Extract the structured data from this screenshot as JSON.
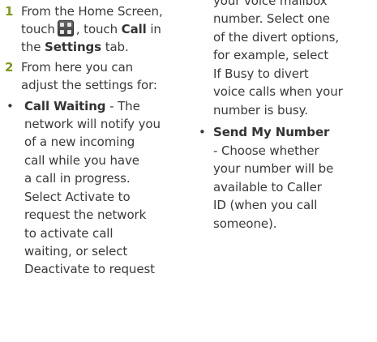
{
  "left": {
    "step1": {
      "num": "1",
      "line1": "From the Home Screen,",
      "line2_pre": "touch",
      "line2_mid": ", touch",
      "line2_call": "Call",
      "line2_post": "in",
      "line3_pre": "the",
      "line3_bold": "Settings",
      "line3_post": "tab.",
      "icon": "apps-grid-icon"
    },
    "step2": {
      "num": "2",
      "line1": "From here you can",
      "line2": "adjust the settings for:"
    },
    "call_waiting": {
      "bullet": "•",
      "title": "Call Waiting",
      "title_rest": "- The",
      "lines": [
        "network will notify you",
        "of a new incoming",
        "call while you have",
        "a call in progress.",
        "Select Activate to",
        "request the network",
        "to activate call",
        "waiting, or select",
        "Deactivate to request"
      ]
    }
  },
  "right": {
    "divert_lines": [
      "your voice mailbox",
      "number. Select one",
      "of the divert options,",
      "for example, select",
      "If Busy to divert",
      "voice calls when your",
      "number is busy."
    ],
    "send_my_number": {
      "bullet": "•",
      "title": "Send My Number",
      "lines": [
        "- Choose whether",
        "your number will be",
        "available to Caller",
        "ID (when you call",
        "someone)."
      ]
    }
  }
}
